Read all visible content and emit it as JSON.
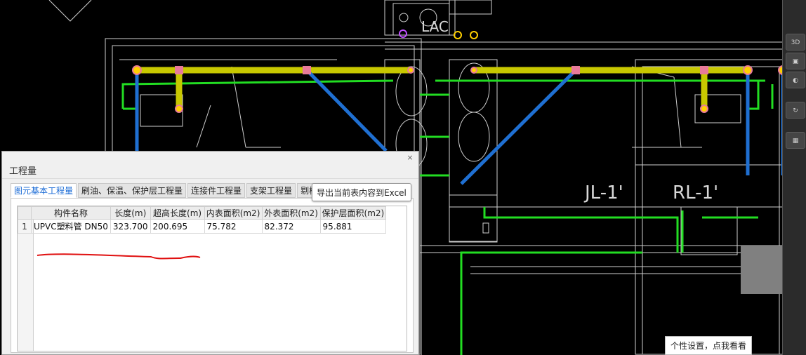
{
  "drawing": {
    "labels": [
      "JL-1'",
      "RL-1'",
      "LAC"
    ],
    "colors": {
      "background": "#000000",
      "pipe_yellow": "#c8c800",
      "pipe_green": "#22dd22",
      "pipe_blue": "#1f6fd1",
      "node_pink": "#e87a9a",
      "lines": "#cfcfcf"
    }
  },
  "dialog": {
    "title": "工程量",
    "close_icon": "×",
    "tabs": [
      "图元基本工程量",
      "刷油、保温、保护层工程量",
      "连接件工程量",
      "支架工程量",
      "剔槽"
    ],
    "active_tab": 0,
    "export_button": "导出当前表内容到Excel",
    "table": {
      "columns": [
        "构件名称",
        "长度(m)",
        "超高长度(m)",
        "内表面积(m2)",
        "外表面积(m2)",
        "保护层面积(m2)"
      ],
      "rows": [
        {
          "index": "1",
          "cells": [
            "UPVC塑料管 DN50",
            "323.700",
            "200.695",
            "75.782",
            "82.372",
            "95.881"
          ]
        }
      ]
    }
  },
  "toolbar": {
    "buttons": [
      "3D",
      "",
      "",
      "",
      ""
    ]
  },
  "tip": "个性设置，点我看看"
}
